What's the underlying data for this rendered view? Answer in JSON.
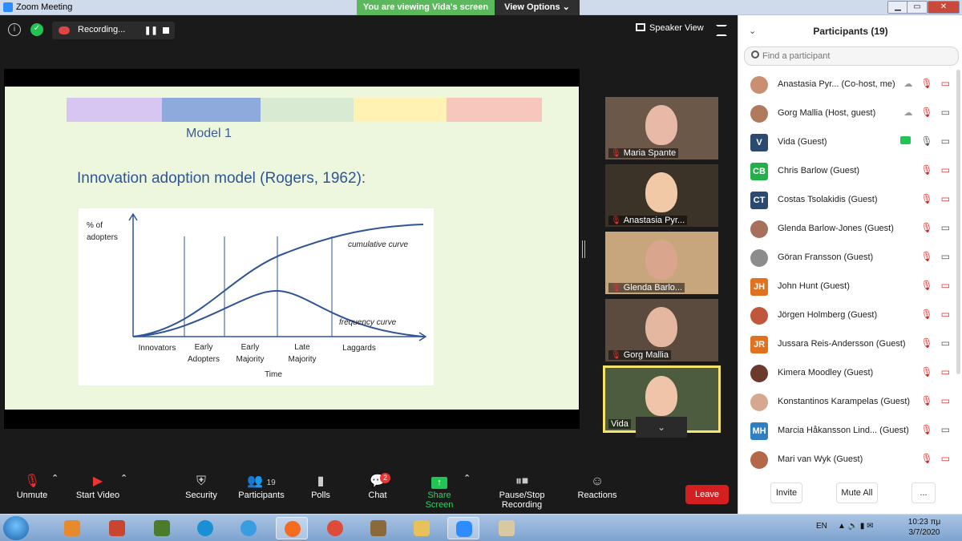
{
  "window": {
    "title": "Zoom Meeting",
    "viewing_banner": "You are viewing Vida's screen",
    "view_options": "View Options",
    "minimize": "▁",
    "maximize": "▭",
    "close": "✕"
  },
  "meeting": {
    "recording_label": "Recording...",
    "speaker_view": "Speaker View"
  },
  "slide": {
    "model_title": "Model 1",
    "heading": "Innovation adoption model (Rogers, 1962):",
    "color_bar": [
      "#d8c6f2",
      "#8ea9db",
      "#d9ead3",
      "#fff2b3",
      "#f7c6bd"
    ],
    "figure": {
      "y_label_line1": "% of",
      "y_label_line2": "adopters",
      "cumulative_label": "cumulative curve",
      "frequency_label": "frequency curve",
      "categories": [
        {
          "line1": "Innovators",
          "line2": ""
        },
        {
          "line1": "Early",
          "line2": "Adopters"
        },
        {
          "line1": "Early",
          "line2": "Majority"
        },
        {
          "line1": "Late",
          "line2": "Majority"
        },
        {
          "line1": "Laggards",
          "line2": ""
        }
      ],
      "x_label": "Time"
    }
  },
  "thumbnails": [
    {
      "name": "Maria Spante",
      "muted": true,
      "bg": "#6b5848",
      "face": "#e8b9a6"
    },
    {
      "name": "Anastasia Pyr...",
      "muted": true,
      "bg": "#3b3328",
      "face": "#f1c9a6"
    },
    {
      "name": "Glenda Barlo...",
      "muted": true,
      "bg": "#c7a67e",
      "face": "#d9a58c"
    },
    {
      "name": "Gorg Mallia",
      "muted": true,
      "bg": "#5a4b3e",
      "face": "#e3b7a0"
    },
    {
      "name": "Vida",
      "muted": false,
      "bg": "#4d5c3e",
      "face": "#f0c4a8"
    }
  ],
  "toolbar": {
    "unmute": "Unmute",
    "start_video": "Start Video",
    "security": "Security",
    "participants": "Participants",
    "participants_count": "19",
    "polls": "Polls",
    "chat": "Chat",
    "chat_badge": "2",
    "share_screen": "Share Screen",
    "pause_stop": "Pause/Stop Recording",
    "reactions": "Reactions",
    "leave": "Leave"
  },
  "panel": {
    "title": "Participants (19)",
    "search_placeholder": "Find a participant",
    "participants": [
      {
        "name": "Anastasia Pyr... (Co-host, me)",
        "initials": "",
        "color": "#c98f70",
        "mic": "muted",
        "video": "off",
        "cloud": true,
        "sharing": false
      },
      {
        "name": "Gorg Mallia (Host, guest)",
        "initials": "",
        "color": "#b07a5d",
        "mic": "muted",
        "video": "on",
        "cloud": true,
        "sharing": false
      },
      {
        "name": "Vida (Guest)",
        "initials": "V",
        "color": "#2b4a6f",
        "mic": "live",
        "video": "on",
        "cloud": false,
        "sharing": true
      },
      {
        "name": "Chris Barlow (Guest)",
        "initials": "CB",
        "color": "#23b04b",
        "mic": "muted",
        "video": "off",
        "cloud": false,
        "sharing": false
      },
      {
        "name": "Costas Tsolakidis (Guest)",
        "initials": "CT",
        "color": "#2b4a6f",
        "mic": "muted",
        "video": "off",
        "cloud": false,
        "sharing": false
      },
      {
        "name": "Glenda Barlow-Jones (Guest)",
        "initials": "",
        "color": "#a6705a",
        "mic": "muted",
        "video": "on",
        "cloud": false,
        "sharing": false
      },
      {
        "name": "Göran Fransson (Guest)",
        "initials": "",
        "color": "#8c8c8c",
        "mic": "muted",
        "video": "on",
        "cloud": false,
        "sharing": false
      },
      {
        "name": "John Hunt (Guest)",
        "initials": "JH",
        "color": "#e2711d",
        "mic": "muted",
        "video": "off",
        "cloud": false,
        "sharing": false
      },
      {
        "name": "Jörgen Holmberg (Guest)",
        "initials": "",
        "color": "#c0563c",
        "mic": "muted",
        "video": "off",
        "cloud": false,
        "sharing": false
      },
      {
        "name": "Jussara Reis-Andersson (Guest)",
        "initials": "JR",
        "color": "#e2711d",
        "mic": "muted",
        "video": "on",
        "cloud": false,
        "sharing": false
      },
      {
        "name": "Kimera Moodley (Guest)",
        "initials": "",
        "color": "#6b3a2a",
        "mic": "muted",
        "video": "off",
        "cloud": false,
        "sharing": false
      },
      {
        "name": "Konstantinos Karampelas (Guest)",
        "initials": "",
        "color": "#d6a88f",
        "mic": "muted",
        "video": "off",
        "cloud": false,
        "sharing": false
      },
      {
        "name": "Marcia Håkansson Lind...  (Guest)",
        "initials": "MH",
        "color": "#2f7fc1",
        "mic": "muted",
        "video": "on",
        "cloud": false,
        "sharing": false
      },
      {
        "name": "Mari van Wyk (Guest)",
        "initials": "",
        "color": "#b5674a",
        "mic": "muted",
        "video": "off",
        "cloud": false,
        "sharing": false
      }
    ],
    "invite": "Invite",
    "mute_all": "Mute All",
    "more": "..."
  },
  "taskbar": {
    "language": "EN",
    "time": "10:23 πμ",
    "date": "3/7/2020"
  }
}
